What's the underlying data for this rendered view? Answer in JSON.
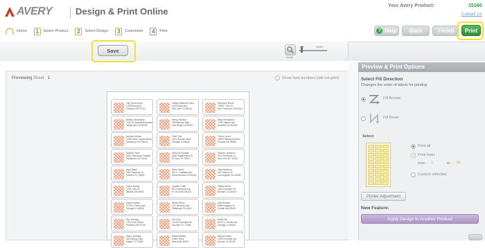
{
  "header": {
    "logo_text": "AVERY",
    "app_title": "Design & Print Online",
    "product_label": "Your Avery Product:",
    "product_code": "15160",
    "contact_link": "Contact Us"
  },
  "steps": [
    {
      "num": "",
      "label": "Home"
    },
    {
      "num": "1",
      "label": "Select Product"
    },
    {
      "num": "2",
      "label": "Select Design"
    },
    {
      "num": "3",
      "label": "Customize"
    },
    {
      "num": "4",
      "label": "Print"
    }
  ],
  "nav": {
    "help": "Help",
    "back": "Back",
    "finish": "Finish",
    "print": "Print"
  },
  "toolbar": {
    "save": "Save",
    "zoom_label": "Zoom",
    "zoom_min": "0%",
    "zoom_max": "100%"
  },
  "preview": {
    "previewing_label": "Previewing",
    "sheet_label": "Sheet",
    "sheet_num": "1",
    "show_numbers": "Show item numbers (will not print)",
    "labels": [
      [
        "Otis Greenwood",
        "1788 Bounty Dr",
        "Portland OR 97211"
      ],
      [
        "Imelda Walmart-Clark",
        "120 Planet Ave",
        "San Jose CA 95124"
      ],
      [
        "Desmond Burns",
        "7768 E 73rd St",
        "San Francisco CA 94111"
      ],
      [
        "Ashley Goodwater",
        "7012 W. Borrelli Boulevard",
        "Hollywood CA 90009"
      ],
      [
        "Henry Hanson",
        "438 Barham Way",
        "San Diego CA 92107"
      ],
      [
        "Betty Hernandez",
        "1782 Saguro Ave",
        "Anaheim CA 92803"
      ],
      [
        "Andrew Nelson",
        "1028 North Crystal Street",
        "Helsinboro CA 95116"
      ],
      [
        "Pixie Fritz",
        "1811 Windsor Blvd",
        "Chicago IL 60640"
      ],
      [
        "Trevor Lyons",
        "19813 Westwood Blvd",
        "Phoenix AZ 85008"
      ],
      [
        "Heather Stan",
        "6461 Glenwood Heights",
        "Pasadena CA 91118"
      ],
      [
        "Anthony Rosetta",
        "1845 Stagecoach Dr",
        "El Paso TX 79912"
      ],
      [
        "Maxine Lawrence",
        "570 Fernwood Ln",
        "New York NY 10032"
      ],
      [
        "Sam Blake",
        "2900 Neptune Dr",
        "Orlando FL 32809"
      ],
      [
        "Norm Hazel",
        "901 S. Oakdale Ave",
        "Santa Monica CA 90401"
      ],
      [
        "Jose Martinez",
        "452 Sulphur Dr",
        "Los Angeles CA 90048"
      ],
      [
        "Karen Spring",
        "1233 Tony Dr",
        "Atlanta GA 30303"
      ],
      [
        "Lynette Cutler",
        "876 Eastmont Ave",
        "St. Paul MN 55106"
      ],
      [
        "Tiffany Wood",
        "1842 Schuster Rd",
        "Boulder CO 80301"
      ],
      [
        "Gwen Brooks",
        "3775 N. Sunny Ave",
        "Chicago IL 60618"
      ],
      [
        "Stuart Harris",
        "121 Windlow Ave",
        "Pittsburgh PA 15217"
      ],
      [
        "Lisa Stewart",
        "8896 Kingsley Dr",
        "Seattle WA 98102"
      ],
      [
        "Roy Harding",
        "740 Grove Street",
        "Portland OR 97215"
      ],
      [
        "Tim Kurt",
        "11145 Greenfield Dr",
        "Houston TX 77084"
      ],
      [
        "Eddie Mix",
        "8774 N. Seville Ave",
        "Chicago IL 60640"
      ],
      [
        "Jason Harding",
        "600 Spring Lane",
        "Dallas TX 75248"
      ],
      [
        "Wilma Shelby",
        "8 Mile Drive",
        "Detroit MI 48213"
      ],
      [
        "Nancy Knight",
        "1290 Ferndale Ave",
        "Denver CO 80207"
      ]
    ]
  },
  "panel": {
    "title": "Preview & Print Options",
    "fill_title": "Select Fill Direction",
    "fill_sub": "Changes the order of labels for printing",
    "fill_across": "Fill Across",
    "fill_down": "Fill Down",
    "select_label": "Select",
    "print_all": "Print all",
    "print_from": "Print from:",
    "from": "from",
    "from_val": "1",
    "to": "to",
    "to_val": "30",
    "custom": "Custom selection",
    "printer_adjust": "Printer Adjustment",
    "new_feature": "New Feature:",
    "apply_design": "Apply Design to Another Product"
  }
}
